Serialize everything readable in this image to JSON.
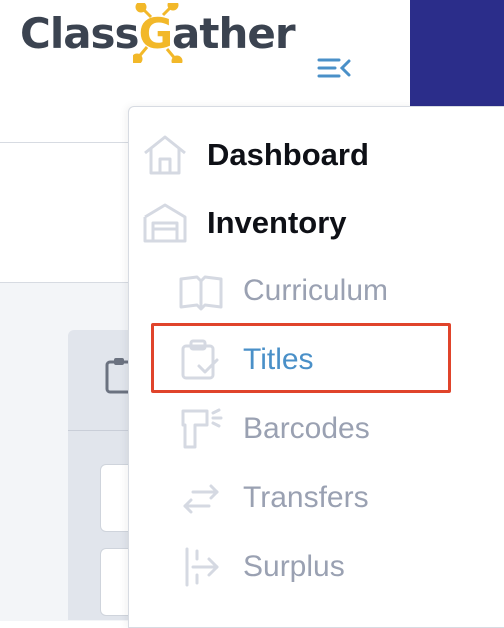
{
  "app": {
    "logo_part1": "Class",
    "logo_g": "G",
    "logo_part2": "ather"
  },
  "colors": {
    "brand_dark": "#3b4350",
    "brand_gold": "#f2b829",
    "header_band": "#2b2d8a",
    "active_item": "#4a90c8",
    "inactive_item": "#9aa1b2",
    "highlight": "#e0442b"
  },
  "sidebar": {
    "collapse_icon": "menu-collapse-icon",
    "items": [
      {
        "label": "Dashboard",
        "icon": "home-icon",
        "level": "top",
        "active": false
      },
      {
        "label": "Inventory",
        "icon": "warehouse-icon",
        "level": "top",
        "active": false
      },
      {
        "label": "Curriculum",
        "icon": "book-icon",
        "level": "sub",
        "active": false
      },
      {
        "label": "Titles",
        "icon": "clipboard-check-icon",
        "level": "sub",
        "active": true
      },
      {
        "label": "Barcodes",
        "icon": "barcode-scanner-icon",
        "level": "sub",
        "active": false
      },
      {
        "label": "Transfers",
        "icon": "transfer-arrows-icon",
        "level": "sub",
        "active": false
      },
      {
        "label": "Surplus",
        "icon": "surplus-icon",
        "level": "sub",
        "active": false
      }
    ]
  }
}
